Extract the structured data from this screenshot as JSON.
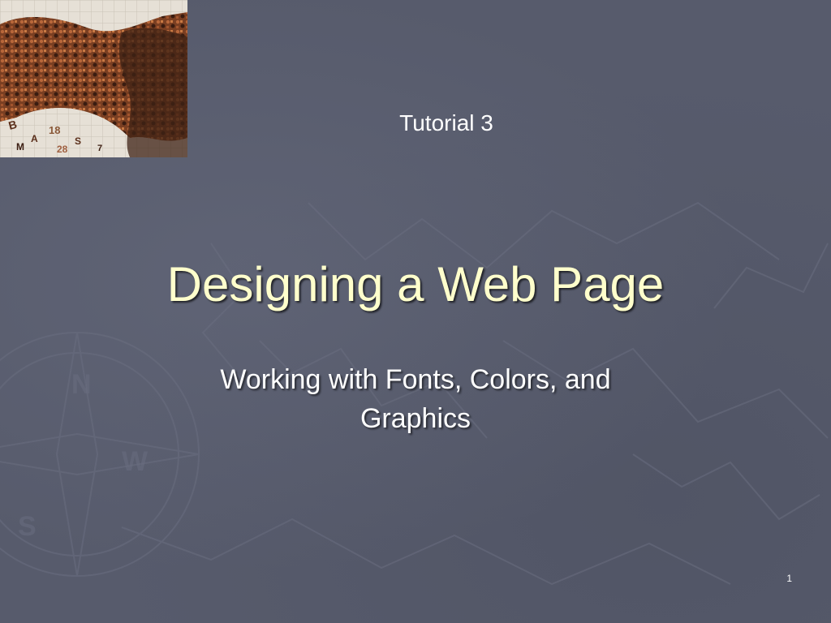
{
  "slide": {
    "tutorial_label": "Tutorial 3",
    "title": "Designing a Web Page",
    "subtitle_line1": "Working with Fonts, Colors, and",
    "subtitle_line2": "Graphics",
    "slide_number": "1"
  },
  "colors": {
    "background": "#575b6c",
    "title": "#ffffcc",
    "text": "#ffffff"
  },
  "graphics": {
    "corner_image": "letters-collage-image",
    "background_watermark": "compass-map-watermark"
  }
}
